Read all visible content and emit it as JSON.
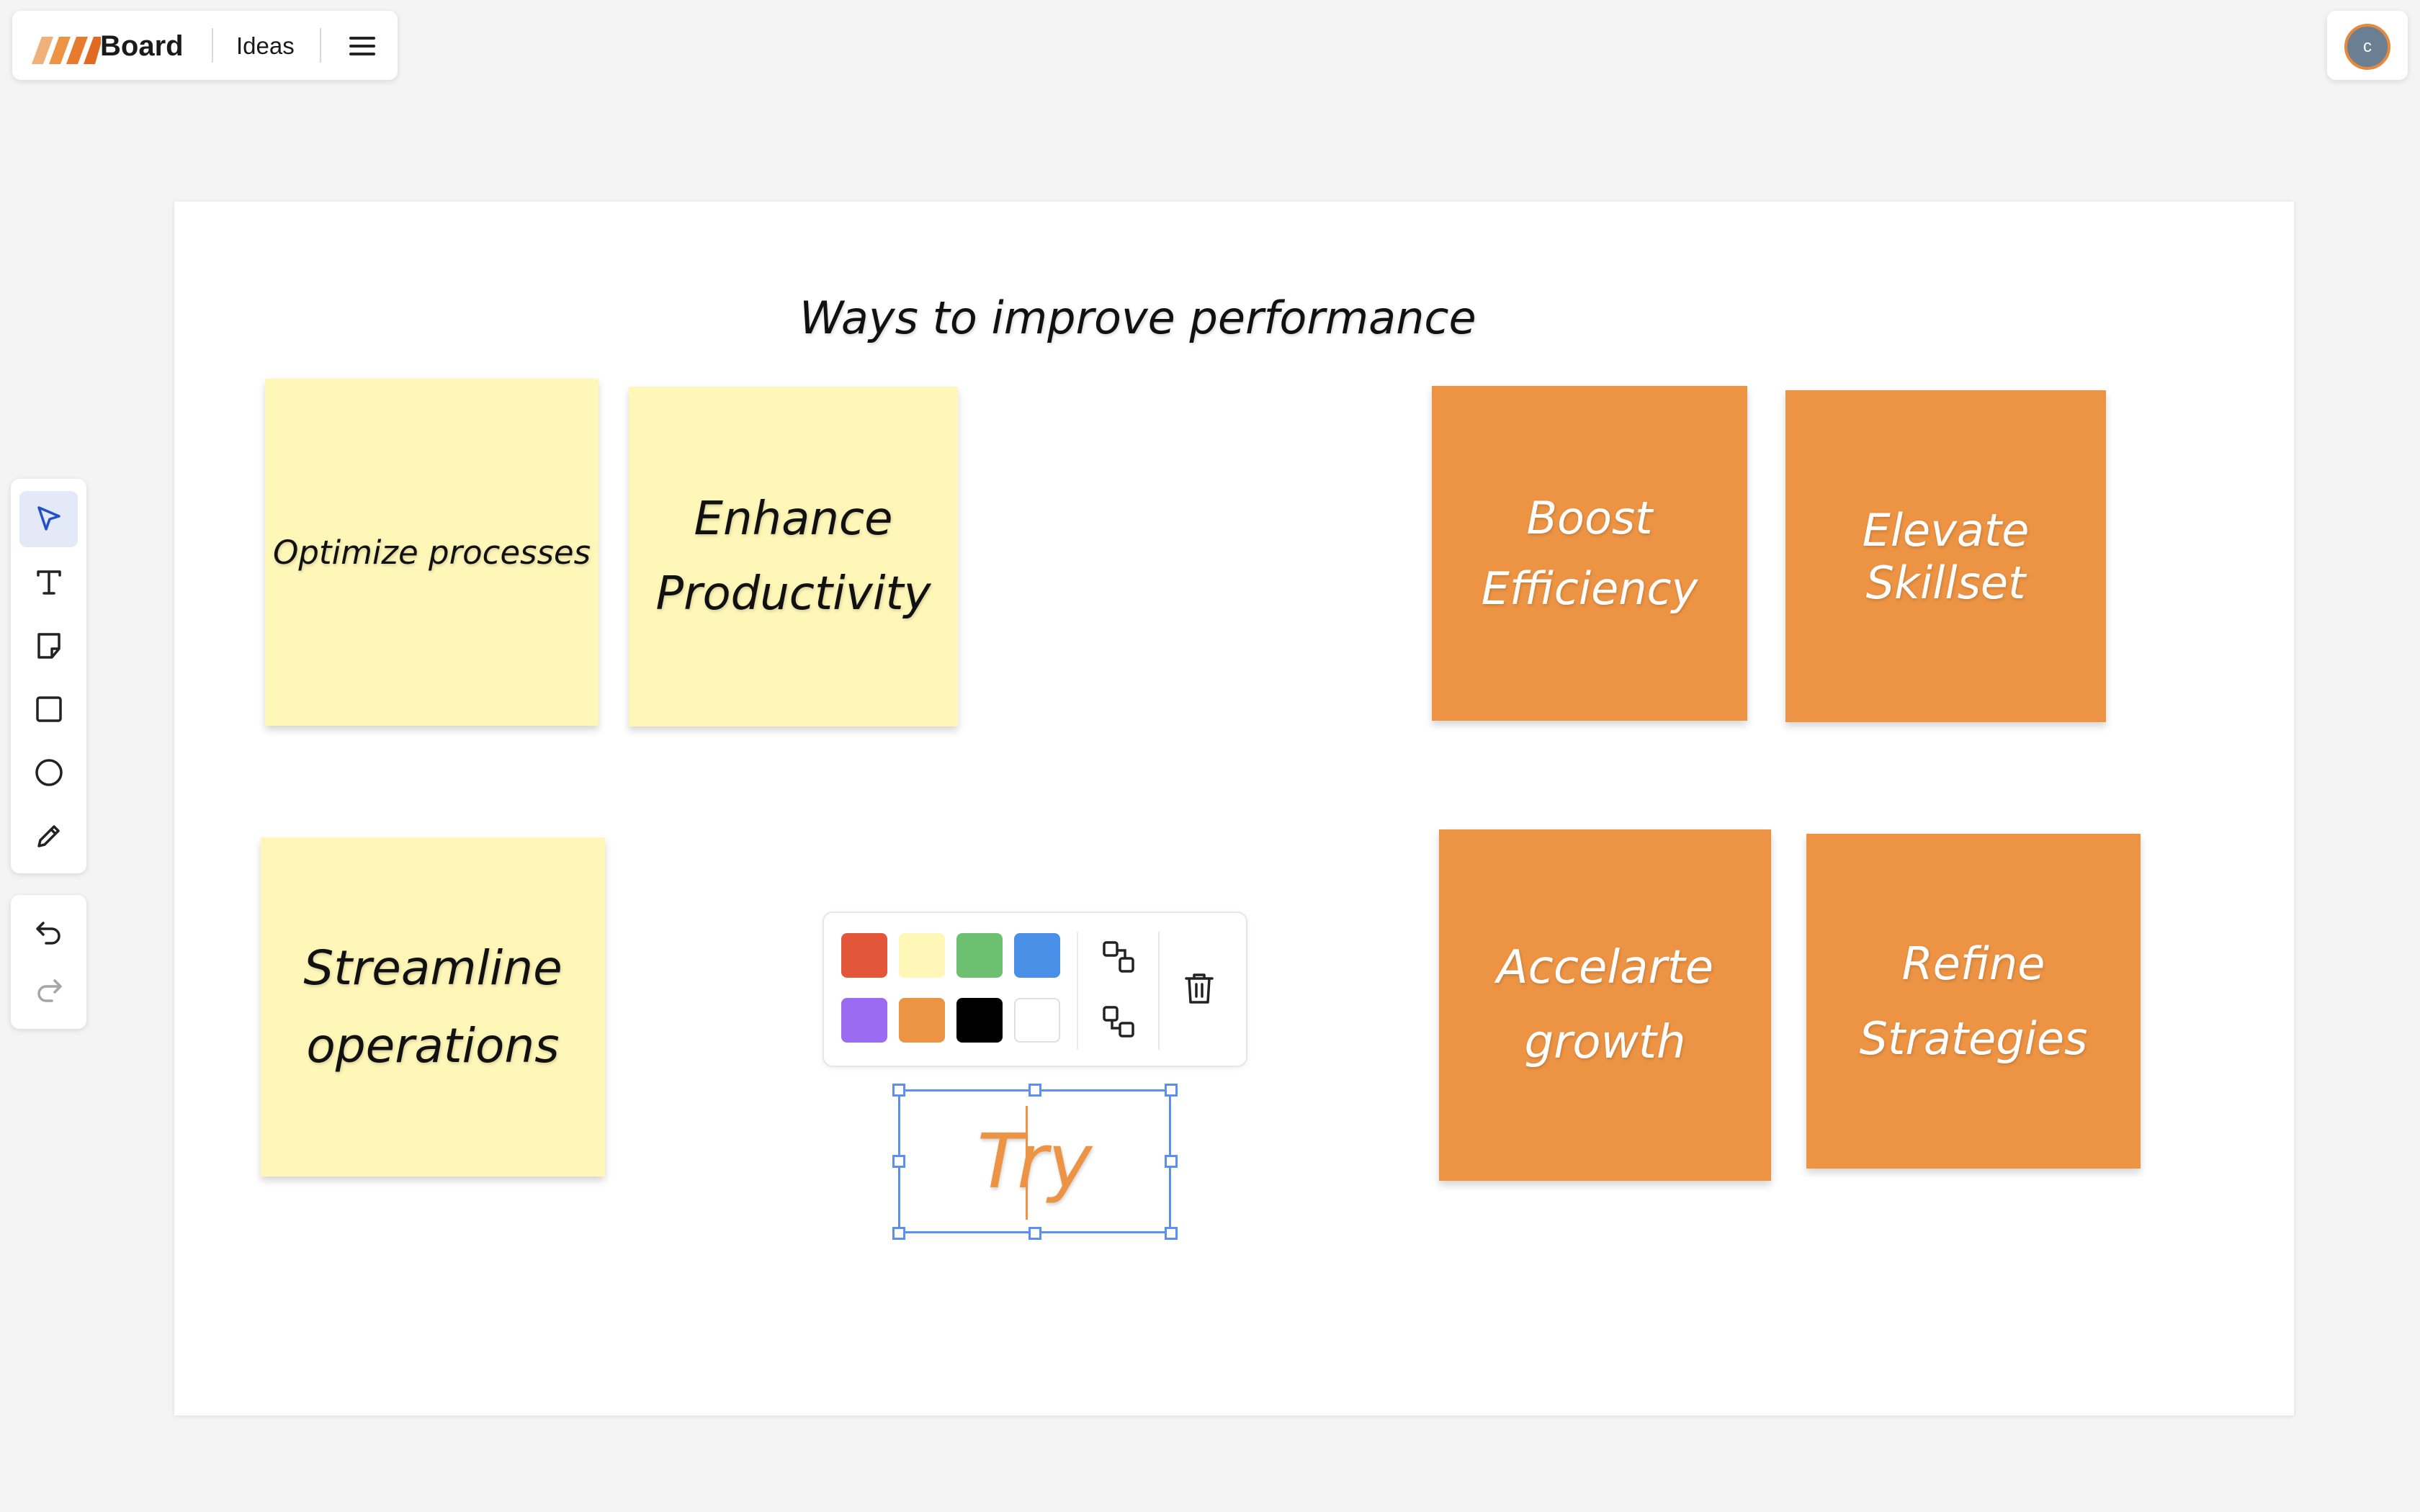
{
  "header": {
    "brand": "Board",
    "board_name": "Ideas",
    "logo_color": "#ed8a3c"
  },
  "user": {
    "initial": "c",
    "avatar_color": "#6b7f92",
    "ring_color": "#e6893b"
  },
  "toolbar": {
    "tools": [
      "select-tool",
      "text-tool",
      "sticky-note-tool",
      "rectangle-tool",
      "ellipse-tool",
      "pen-tool"
    ],
    "active_tool": "select-tool",
    "history": [
      "undo",
      "redo"
    ]
  },
  "canvas": {
    "title": "Ways to improve performance",
    "notes": [
      {
        "text": "Optimize processes",
        "color": "#fff7b8"
      },
      {
        "text": "Enhance\nProductivity",
        "color": "#fff7b8"
      },
      {
        "text": "Boost\nEfficiency",
        "color": "#ed9444"
      },
      {
        "text": "Elevate Skillset",
        "color": "#ed9444"
      },
      {
        "text": "Streamline\noperations",
        "color": "#fff7b8"
      },
      {
        "text": "Accelarte\ngrowth",
        "color": "#ed9444"
      },
      {
        "text": "Refine\nStrategies",
        "color": "#ed9444"
      }
    ],
    "selected_text": "Try",
    "selected_text_color": "#ed9444"
  },
  "popup": {
    "colors": [
      "#e2573a",
      "#fff7b8",
      "#6cc070",
      "#4a8fe7",
      "#9b6bf2",
      "#ed9444",
      "#000000",
      "#ffffff"
    ],
    "actions": [
      "bring-forward",
      "send-backward",
      "delete"
    ]
  }
}
